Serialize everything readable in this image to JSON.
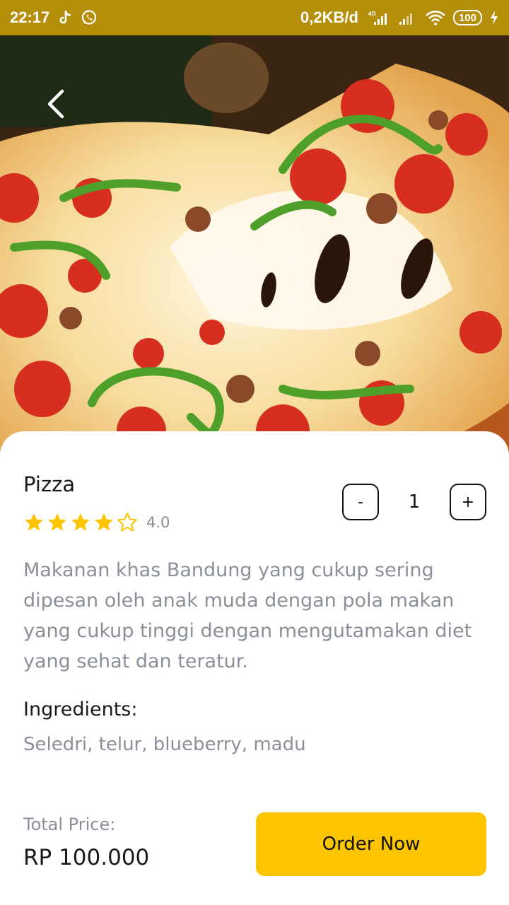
{
  "status_bar": {
    "time": "22:17",
    "network_speed": "0,2KB/d",
    "network_type": "4G",
    "battery": "100",
    "icons": [
      "tiktok-icon",
      "whatsapp-icon",
      "signal-icon",
      "wifi-icon",
      "charging-icon"
    ]
  },
  "hero": {
    "image": "pizza-photo",
    "back_icon": "chevron-left-icon"
  },
  "product": {
    "title": "Pizza",
    "rating": 4.0,
    "rating_label": "4.0",
    "stars_filled": 4,
    "stars_total": 5,
    "description": "Makanan khas Bandung yang cukup sering dipesan oleh anak muda dengan pola makan yang cukup tinggi dengan mengutamakan diet yang sehat dan teratur.",
    "ingredients_title": "Ingredients:",
    "ingredients": "Seledri, telur, blueberry, madu"
  },
  "quantity": {
    "minus_label": "-",
    "value": "1",
    "plus_label": "+"
  },
  "checkout": {
    "total_label": "Total Price:",
    "total_value": "RP 100.000",
    "order_label": "Order Now"
  },
  "colors": {
    "status_bar": "#b58f0a",
    "accent": "#fdc500",
    "star": "#fdc500",
    "muted_text": "#8a8f99"
  }
}
